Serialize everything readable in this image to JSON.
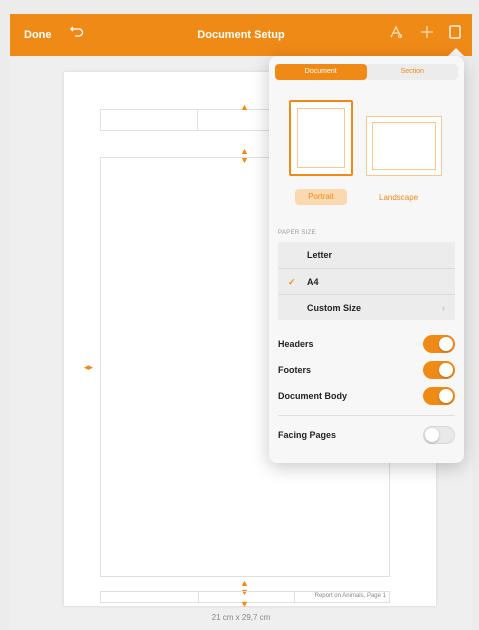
{
  "toolbar": {
    "done_label": "Done",
    "title": "Document Setup",
    "icons": [
      "undo-icon",
      "brush-icon",
      "plus-icon",
      "document-icon"
    ]
  },
  "page": {
    "footer_text": "Report on Animals, Page 1",
    "dimensions": "21 cm x 29,7 cm"
  },
  "popover": {
    "tabs": [
      {
        "label": "Document",
        "active": true
      },
      {
        "label": "Section",
        "active": false
      }
    ],
    "orientation": {
      "portrait_label": "Portrait",
      "landscape_label": "Landscape",
      "selected": "Portrait"
    },
    "paper_size": {
      "heading": "PAPER SIZE",
      "options": [
        {
          "label": "Letter",
          "selected": false
        },
        {
          "label": "A4",
          "selected": true
        },
        {
          "label": "Custom Size",
          "selected": false
        }
      ]
    },
    "toggles": [
      {
        "label": "Headers",
        "on": true
      },
      {
        "label": "Footers",
        "on": true
      },
      {
        "label": "Document Body",
        "on": true
      },
      {
        "label": "Facing Pages",
        "on": false
      }
    ]
  },
  "colors": {
    "accent": "#f08a17"
  }
}
